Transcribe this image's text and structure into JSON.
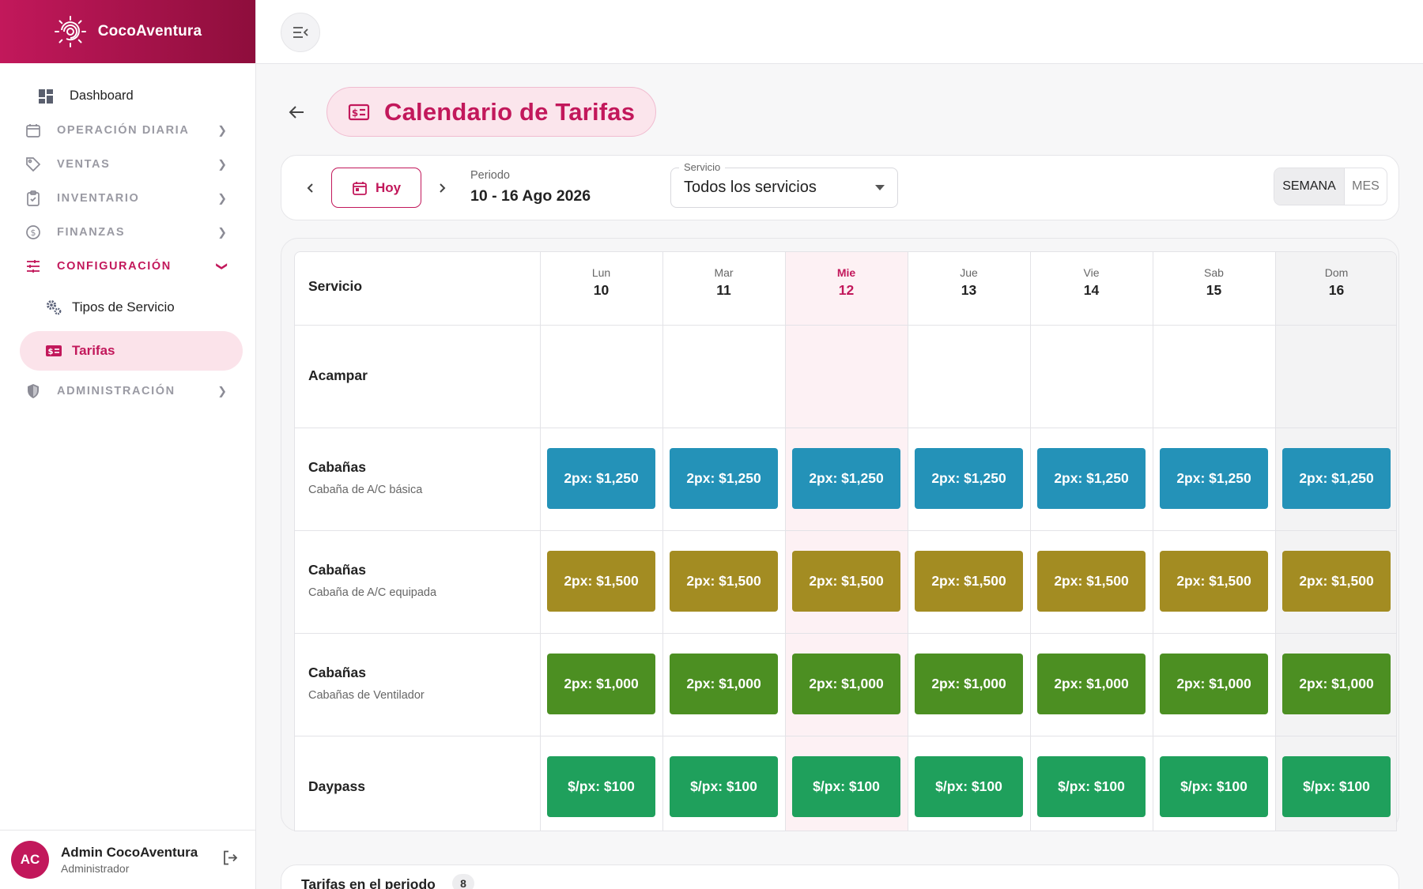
{
  "app": {
    "name": "CocoAventura"
  },
  "sidebar": {
    "items": [
      {
        "label": "Dashboard",
        "icon": "dashboard-icon"
      },
      {
        "label": "OPERACIÓN DIARIA",
        "icon": "calendar-icon"
      },
      {
        "label": "VENTAS",
        "icon": "tag-icon"
      },
      {
        "label": "INVENTARIO",
        "icon": "clipboard-icon"
      },
      {
        "label": "FINANZAS",
        "icon": "dollar-circle-icon"
      },
      {
        "label": "CONFIGURACIÓN",
        "icon": "sliders-icon",
        "expanded": true
      },
      {
        "label": "ADMINISTRACIÓN",
        "icon": "shield-icon"
      }
    ],
    "sub_items": [
      {
        "label": "Tipos de Servicio",
        "icon": "gears-icon"
      },
      {
        "label": "Tarifas",
        "icon": "rate-card-icon",
        "active": true
      }
    ]
  },
  "user": {
    "initials": "AC",
    "name": "Admin CocoAventura",
    "role": "Administrador"
  },
  "page": {
    "title": "Calendario de Tarifas"
  },
  "toolbar": {
    "today_label": "Hoy",
    "period_label": "Periodo",
    "period_value": "10 - 16 Ago 2026",
    "service_label": "Servicio",
    "service_value": "Todos los servicios",
    "view_week": "SEMANA",
    "view_month": "MES",
    "active_view": "SEMANA"
  },
  "calendar": {
    "service_header": "Servicio",
    "days": [
      {
        "name": "Lun",
        "date": "10"
      },
      {
        "name": "Mar",
        "date": "11"
      },
      {
        "name": "Mie",
        "date": "12",
        "today": true
      },
      {
        "name": "Jue",
        "date": "13"
      },
      {
        "name": "Vie",
        "date": "14"
      },
      {
        "name": "Sab",
        "date": "15"
      },
      {
        "name": "Dom",
        "date": "16"
      }
    ],
    "rows": [
      {
        "name": "Acampar",
        "subtitle": "",
        "rate": "",
        "color": ""
      },
      {
        "name": "Cabañas",
        "subtitle": "Cabaña de A/C básica",
        "rate": "2px: $1,250",
        "color": "#2492b8"
      },
      {
        "name": "Cabañas",
        "subtitle": "Cabaña de A/C equipada",
        "rate": "2px: $1,500",
        "color": "#a38c22"
      },
      {
        "name": "Cabañas",
        "subtitle": "Cabañas de Ventilador",
        "rate": "2px: $1,000",
        "color": "#4c8f22"
      },
      {
        "name": "Daypass",
        "subtitle": "",
        "rate": "$/px: $100",
        "color": "#1fa05c"
      }
    ]
  },
  "summary": {
    "title": "Tarifas en el periodo",
    "count": "8"
  },
  "colors": {
    "brand": "#c2185b",
    "brand_dark": "#8e0e3c"
  }
}
